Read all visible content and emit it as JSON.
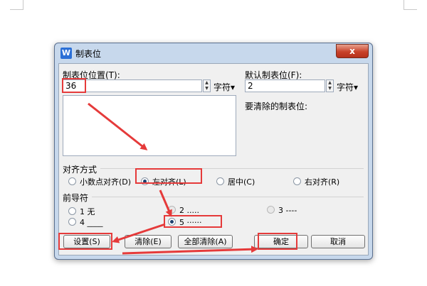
{
  "dialog": {
    "title": "制表位",
    "app_icon": "W",
    "close_icon": "x"
  },
  "tab_position": {
    "label": "制表位位置(T):",
    "value": "36",
    "unit": "字符▾"
  },
  "default_tab": {
    "label": "默认制表位(F):",
    "value": "2",
    "unit": "字符▾"
  },
  "clear_list_label": "要清除的制表位:",
  "alignment": {
    "label": "对齐方式",
    "options": [
      {
        "label": "小数点对齐(D)",
        "selected": false
      },
      {
        "label": "左对齐(L)",
        "selected": true
      },
      {
        "label": "居中(C)",
        "selected": false
      },
      {
        "label": "右对齐(R)",
        "selected": false
      }
    ]
  },
  "leader": {
    "label": "前导符",
    "options": [
      {
        "label": "1 无",
        "selected": false
      },
      {
        "label": "2 .....",
        "selected": false
      },
      {
        "label": "3 ----",
        "selected": false
      },
      {
        "label": "4 ____",
        "selected": false
      },
      {
        "label": "5 ······",
        "selected": true
      }
    ]
  },
  "buttons": {
    "set": "设置(S)",
    "clear": "清除(E)",
    "clear_all": "全部清除(A)",
    "ok": "确定",
    "cancel": "取消"
  },
  "colors": {
    "highlight": "#e53a3a",
    "dialog_frame": "#c7d8ec"
  }
}
